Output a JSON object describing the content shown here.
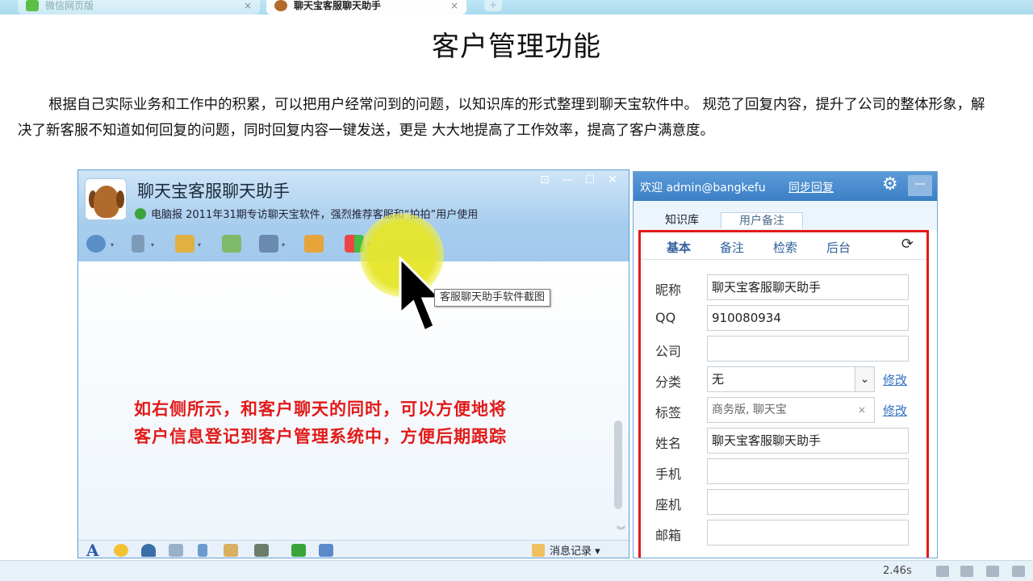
{
  "browser": {
    "tabs": [
      {
        "label": "微信网页版",
        "active": false
      },
      {
        "label": "聊天宝客服聊天助手",
        "active": true
      }
    ],
    "close_glyph": "×",
    "new_tab_glyph": "+"
  },
  "slide": {
    "title": "客户管理功能",
    "paragraph": "根据自己实际业务和工作中的积累，可以把用户经常问到的问题，以知识库的形式整理到聊天宝软件中。 规范了回复内容，提升了公司的整体形象，解决了新客服不知道如何回复的问题，同时回复内容一键发送，更是 大大地提高了工作效率，提高了客户满意度。"
  },
  "chat_window": {
    "name": "聊天宝客服聊天助手",
    "status": "电脑报 2011年31期专访聊天宝软件，强烈推荐客服和“拍拍”用户使用",
    "window_buttons": [
      "⊡",
      "—",
      "☐",
      "✕"
    ],
    "tooltip": "客服聊天助手软件截图",
    "annotation_lines": [
      "如右侧所示，和客户聊天的同时，可以方便地将",
      "客户信息登记到客户管理系统中，方便后期跟踪"
    ],
    "message_log_label": "消息记录",
    "font_icon_glyph": "A",
    "dropdown_glyph": "▾",
    "scroll_down_glyph": "︾"
  },
  "crm_panel": {
    "welcome": "欢迎 admin@bangkefu",
    "sync_link": "同步回复",
    "gear_glyph": "⚙",
    "min_glyph": "—",
    "tabs": [
      "知识库",
      "用户备注"
    ],
    "subtabs": [
      "基本",
      "备注",
      "检索",
      "后台"
    ],
    "refresh_glyph": "⟳",
    "fields": {
      "nickname": {
        "label": "昵称",
        "value": "聊天宝客服聊天助手"
      },
      "qq": {
        "label": "QQ",
        "value": "910080934"
      },
      "company": {
        "label": "公司",
        "value": ""
      },
      "category": {
        "label": "分类",
        "value": "无",
        "link": "修改"
      },
      "tags": {
        "label": "标签",
        "value": "商务版, 聊天宝",
        "link": "修改"
      },
      "name": {
        "label": "姓名",
        "value": "聊天宝客服聊天助手"
      },
      "mobile": {
        "label": "手机",
        "value": ""
      },
      "landline": {
        "label": "座机",
        "value": ""
      },
      "email": {
        "label": "邮箱",
        "value": ""
      }
    },
    "select_arrow": "⌄",
    "tag_x": "×"
  },
  "taskbar": {
    "net_speed": "2.46s"
  },
  "colors": {
    "accent_red": "#e21a1a",
    "header_blue": "#a7cdee",
    "panel_blue": "#3b7fc6",
    "highlight_yellow": "#e6e628"
  }
}
